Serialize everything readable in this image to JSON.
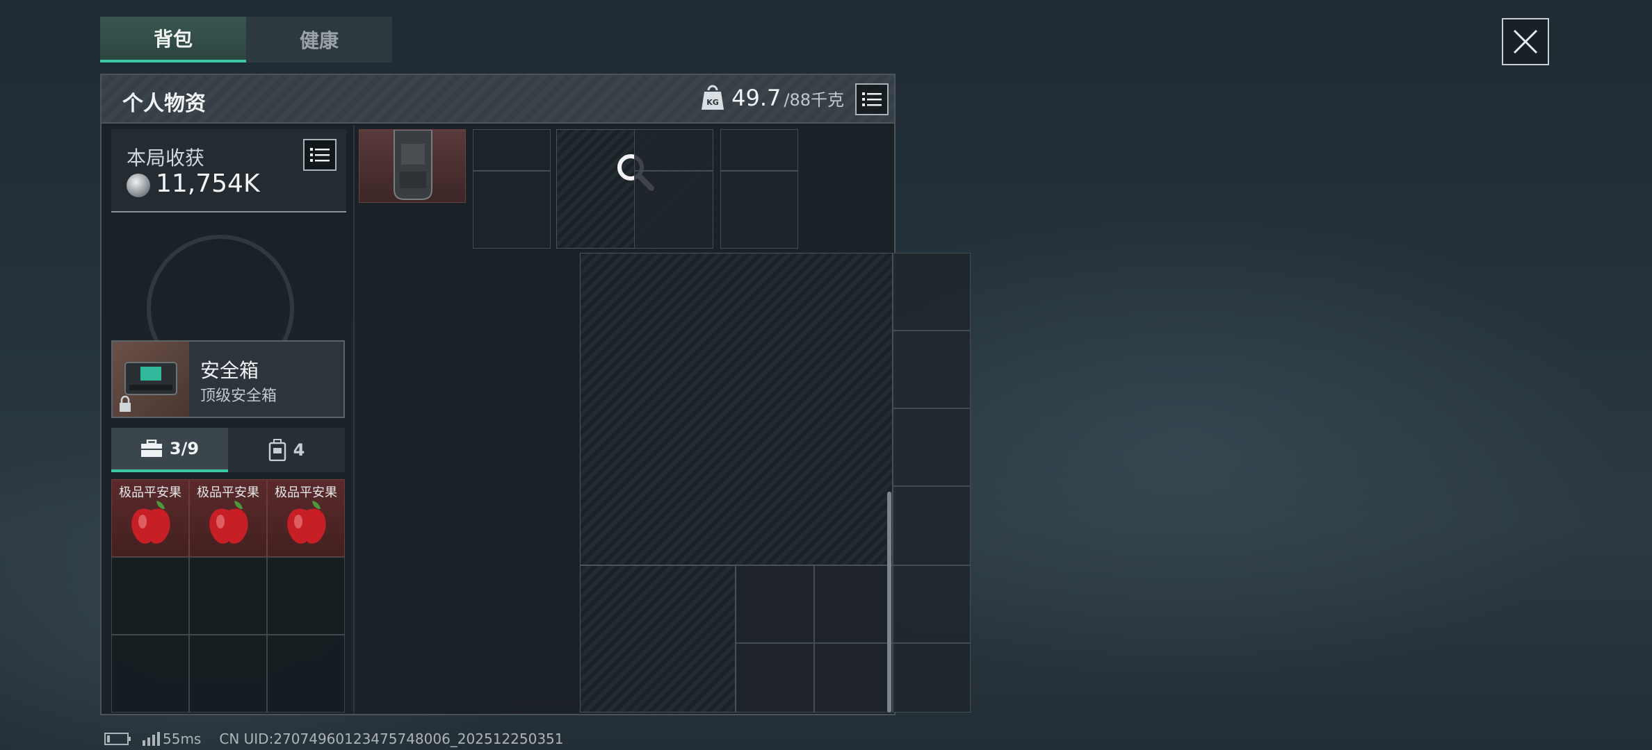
{
  "tabs": [
    {
      "label": "背包",
      "active": true
    },
    {
      "label": "健康",
      "active": false
    }
  ],
  "panel": {
    "title": "个人物资",
    "weight_current": "49.7",
    "weight_max": "/88千克"
  },
  "earnings": {
    "label": "本局收获",
    "value": "11,754K"
  },
  "safe_box": {
    "name": "安全箱",
    "subtitle": "顶级安全箱"
  },
  "pouch_tabs": [
    {
      "label": "3/9",
      "icon": "briefcase-icon",
      "active": true
    },
    {
      "label": "4",
      "icon": "backpack-icon",
      "active": false
    }
  ],
  "pouch_items": [
    {
      "label": "极品平安果"
    },
    {
      "label": "极品平安果"
    },
    {
      "label": "极品平安果"
    }
  ],
  "status": {
    "ping": "55ms",
    "uid": "CN UID:27074960123475748006_202512250351"
  },
  "colors": {
    "accent": "#3cc7a5",
    "item_red": "#5a2a2c"
  }
}
